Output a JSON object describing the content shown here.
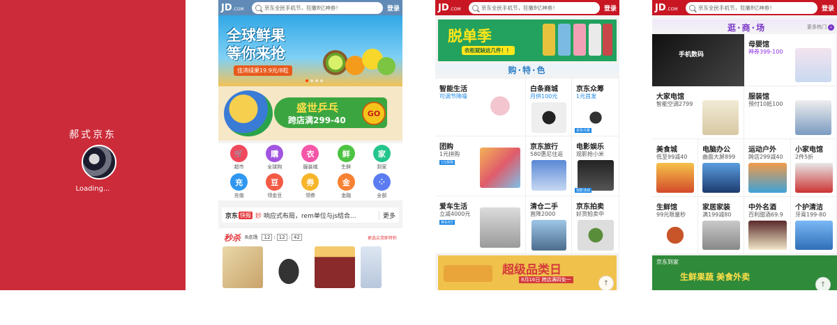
{
  "splash": {
    "title": "郝式京东",
    "loading": "Loading..."
  },
  "header": {
    "logo": "JD",
    "logo_sub": ".COM",
    "search_placeholder": "京东全民手机节，狂撒8亿神券！",
    "login": "登录"
  },
  "phone1": {
    "banner1": {
      "title_line1": "全球鲜果",
      "title_line2": "等你来抢",
      "subtitle": "佳沛绿果19.9元/8粒"
    },
    "banner2": {
      "title": "盛世乒乓",
      "subtitle": "跨店满299-40",
      "go": "GO"
    },
    "icons": [
      {
        "label": "超市",
        "icon": "cart-icon",
        "color": "#f0485c",
        "glyph": "🛒"
      },
      {
        "label": "全球购",
        "icon": "global-buy-icon",
        "color": "#a255e0",
        "glyph": "購"
      },
      {
        "label": "服装城",
        "icon": "clothes-icon",
        "color": "#f556a8",
        "glyph": "衣"
      },
      {
        "label": "生鲜",
        "icon": "fresh-icon",
        "color": "#4dc343",
        "glyph": "鲜"
      },
      {
        "label": "到家",
        "icon": "home-delivery-icon",
        "color": "#23c58c",
        "glyph": "家"
      },
      {
        "label": "充值",
        "icon": "recharge-icon",
        "color": "#2f97f0",
        "glyph": "充"
      },
      {
        "label": "领金豆",
        "icon": "bean-icon",
        "color": "#f45b45",
        "glyph": "豆"
      },
      {
        "label": "领券",
        "icon": "coupon-icon",
        "color": "#f7b52a",
        "glyph": "券"
      },
      {
        "label": "金融",
        "icon": "finance-icon",
        "color": "#f88132",
        "glyph": "金"
      },
      {
        "label": "全部",
        "icon": "all-icon",
        "color": "#5b7cf0",
        "glyph": "⁘"
      }
    ],
    "news": {
      "brand": "京东",
      "badge": "快报",
      "highlight": "妙",
      "text": "响应式布局，rem单位与js结合...",
      "more": "更多"
    },
    "seckill": {
      "title": "秒杀",
      "session": "8点场",
      "h": "12",
      "m": "12",
      "s": "42",
      "more": "更选尖货即将秒"
    }
  },
  "phone2": {
    "banner": {
      "title": "脱单季",
      "subtitle": "衣柜就缺这几件！！"
    },
    "section_title": "购·特·色",
    "tiles": [
      {
        "name": "智能生活",
        "sub": "可调节降噪",
        "sub_style": "blue",
        "tag": ""
      },
      {
        "name": "白条商城",
        "sub": "月供100元",
        "sub_style": "blue",
        "tag": ""
      },
      {
        "name": "京东众筹",
        "sub": "1元首发",
        "sub_style": "blue",
        "tag": "京东众筹"
      },
      {
        "name": "团购",
        "sub": "1元拼购",
        "sub_style": "",
        "tag": "1元拼购"
      },
      {
        "name": "京东旅行",
        "sub": "580惠尼住返",
        "sub_style": "",
        "tag": ""
      },
      {
        "name": "电影娱乐",
        "sub": "观影抢小米",
        "sub_style": "",
        "tag": "观影活动"
      },
      {
        "name": "爱车生活",
        "sub": "立减4000元",
        "sub_style": "",
        "tag": "换车8万"
      },
      {
        "name": "清仓二手",
        "sub": "直降2000",
        "sub_style": "",
        "tag": ""
      },
      {
        "name": "京东拍卖",
        "sub": "好货拍卖中",
        "sub_style": "",
        "tag": ""
      }
    ],
    "bottom_banner": {
      "title": "超级品类日",
      "subtitle": "8月16日 跨店满四免一"
    }
  },
  "phone3": {
    "section_title": "逛·商·场",
    "more": "更多热门",
    "tiles": [
      {
        "name": "",
        "sub": "手机数码"
      },
      {
        "name": "母婴馆",
        "sub": "神券399-100"
      },
      {
        "name": "大家电馆",
        "sub": "智能空调2799"
      },
      {
        "name": "服装馆",
        "sub": "预付10抵100"
      },
      {
        "name": "美食城",
        "sub": "低至99减40"
      },
      {
        "name": "电脑办公",
        "sub": "曲面大屏899"
      },
      {
        "name": "运动户外",
        "sub": "跨店299减40"
      },
      {
        "name": "小家电馆",
        "sub": "2件5折"
      },
      {
        "name": "生鲜馆",
        "sub": "99元限量秒"
      },
      {
        "name": "家居家装",
        "sub": "满199减80"
      },
      {
        "name": "中外名酒",
        "sub": "百利甜酒69.9"
      },
      {
        "name": "个护清洁",
        "sub": "牙膏199-80"
      }
    ],
    "bottom_banner": {
      "brand": "京东到家",
      "title": "生鲜果蔬 美食外卖"
    }
  },
  "to_top": "↑"
}
